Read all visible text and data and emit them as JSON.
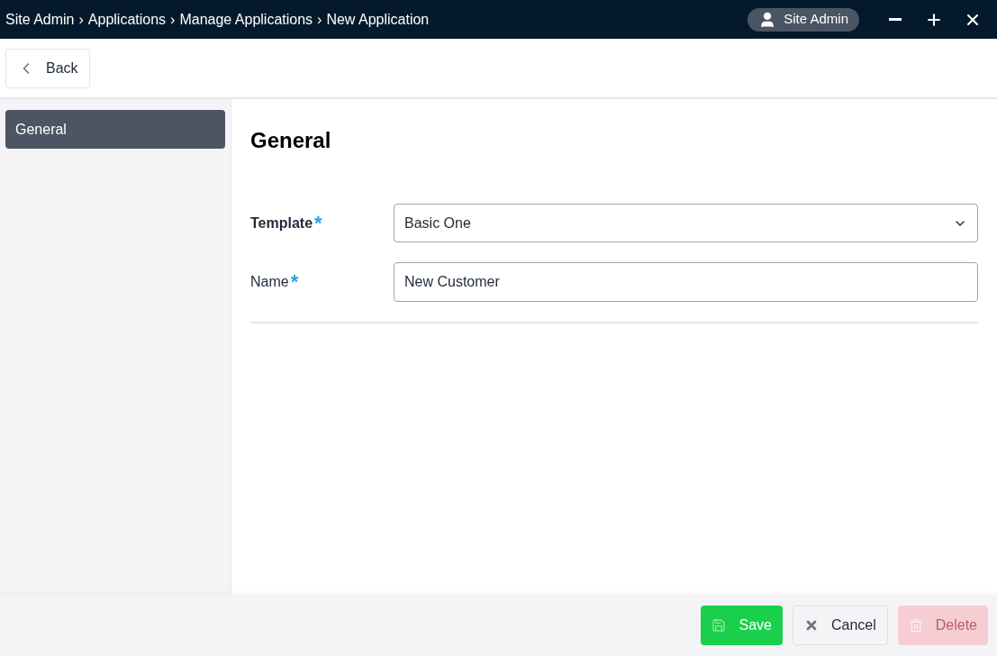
{
  "breadcrumb": {
    "separator": "›",
    "items": [
      "Site Admin",
      "Applications",
      "Manage Applications",
      "New Application"
    ]
  },
  "user": {
    "name": "Site Admin"
  },
  "toolbar": {
    "back": "Back"
  },
  "sidebar": {
    "items": [
      {
        "label": "General",
        "selected": true
      }
    ]
  },
  "section": {
    "title": "General"
  },
  "fields": [
    {
      "kind": "select",
      "label": "Template",
      "bold": true,
      "required": true,
      "value": "Basic One"
    },
    {
      "kind": "text",
      "label": "Name",
      "bold": false,
      "required": true,
      "value": "New Customer"
    }
  ],
  "required_mark": "*",
  "buttons": [
    {
      "kind": "save",
      "label": "Save",
      "disabled": false
    },
    {
      "kind": "cancel",
      "label": "Cancel",
      "disabled": false
    },
    {
      "kind": "delete",
      "label": "Delete",
      "disabled": true
    }
  ]
}
